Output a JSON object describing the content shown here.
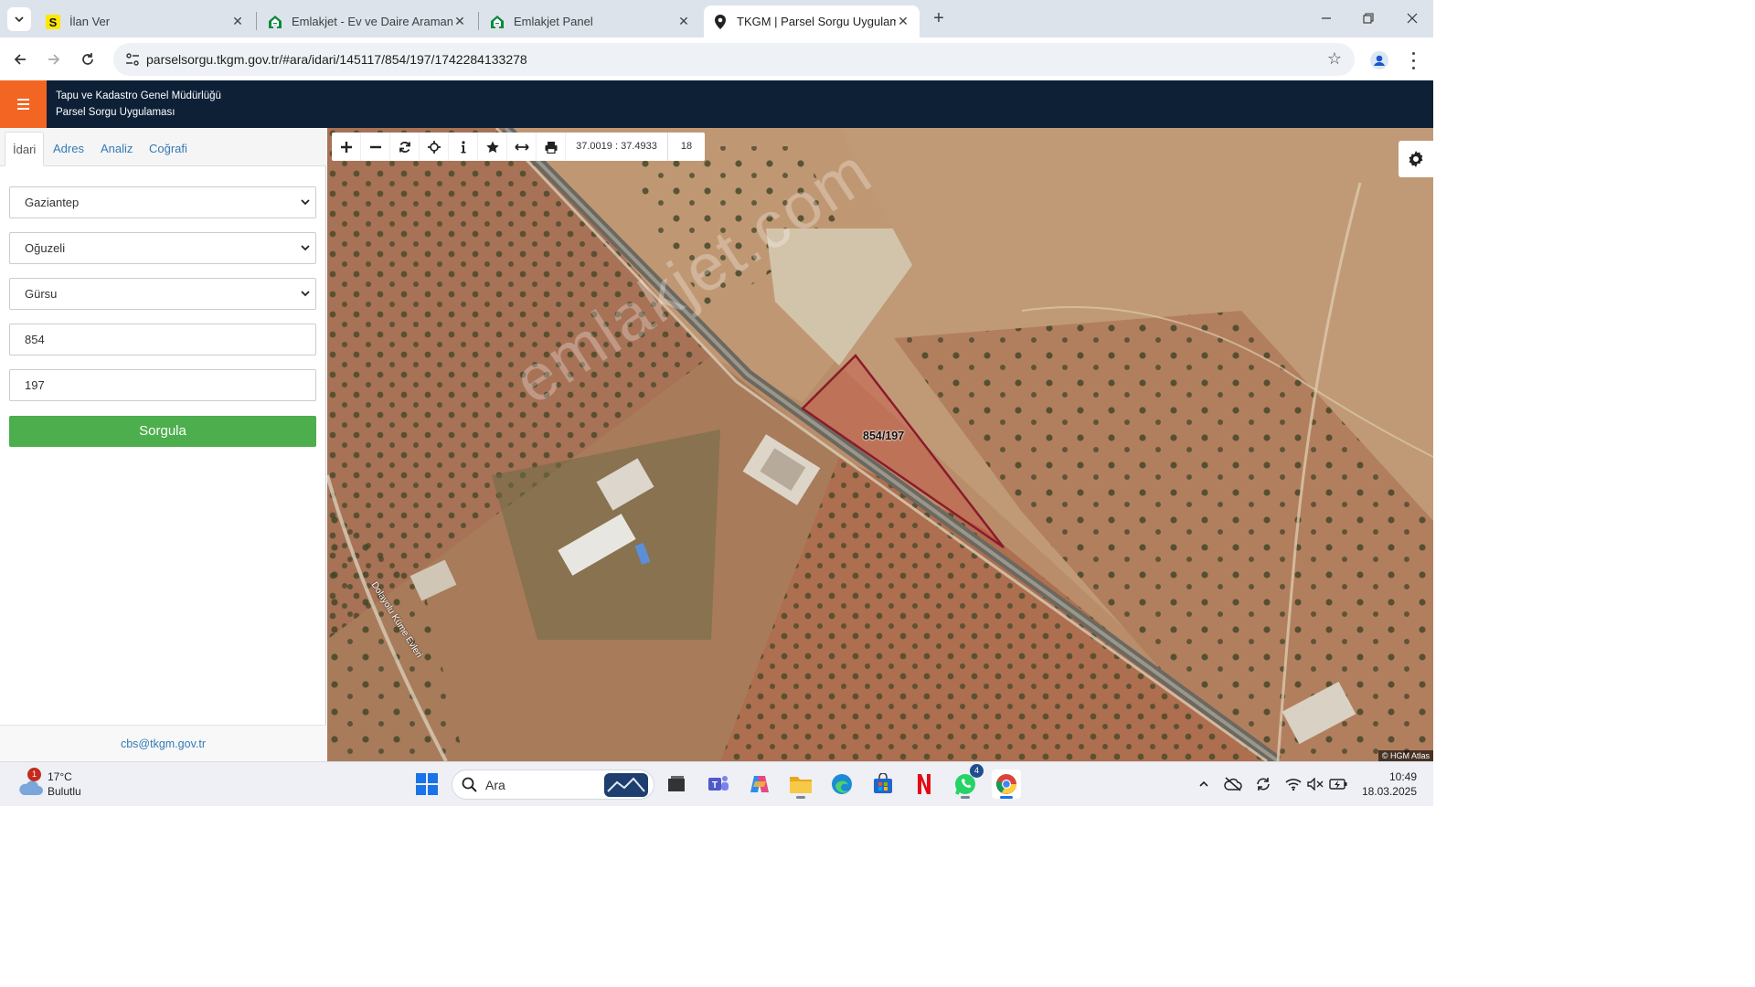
{
  "browser": {
    "tabs": [
      {
        "title": "İlan Ver",
        "favicon": "sahibinden-s-icon"
      },
      {
        "title": "Emlakjet - Ev ve Daire Aramanın",
        "favicon": "emlakjet-house-icon"
      },
      {
        "title": "Emlakjet Panel",
        "favicon": "emlakjet-house-icon"
      },
      {
        "title": "TKGM | Parsel Sorgu Uygulaması",
        "favicon": "map-pin-icon",
        "active": true
      }
    ],
    "url": "parselsorgu.tkgm.gov.tr/#ara/idari/145117/854/197/1742284133278"
  },
  "app": {
    "title_line1": "Tapu ve Kadastro Genel Müdürlüğü",
    "title_line2": "Parsel Sorgu Uygulaması",
    "accent_color": "#f26522",
    "header_color": "#0d2036"
  },
  "sidebar": {
    "tabs": [
      {
        "label": "İdari",
        "active": true
      },
      {
        "label": "Adres"
      },
      {
        "label": "Analiz"
      },
      {
        "label": "Coğrafi"
      }
    ],
    "province": "Gaziantep",
    "district": "Oğuzeli",
    "neighborhood": "Gürsu",
    "block": "854",
    "parcel": "197",
    "submit_label": "Sorgula",
    "submit_color": "#4cae4c",
    "footer_email": "cbs@tkgm.gov.tr"
  },
  "map": {
    "coordinates": "37.0019 : 37.4933",
    "zoom": "18",
    "parcel_label": "854/197",
    "watermark": "emlakjet.com",
    "road_label": "Dolayolu Küme Evleri",
    "attribution": "© HGM Atlas",
    "tools": [
      "zoom-in-icon",
      "zoom-out-icon",
      "refresh-icon",
      "locate-icon",
      "info-icon",
      "star-icon",
      "measure-icon",
      "print-icon"
    ],
    "parcel_color": "#8b1a2b"
  },
  "taskbar": {
    "weather_temp": "17°C",
    "weather_desc": "Bulutlu",
    "weather_badge": "1",
    "search_placeholder": "Ara",
    "whatsapp_badge": "4",
    "time": "10:49",
    "date": "18.03.2025"
  }
}
